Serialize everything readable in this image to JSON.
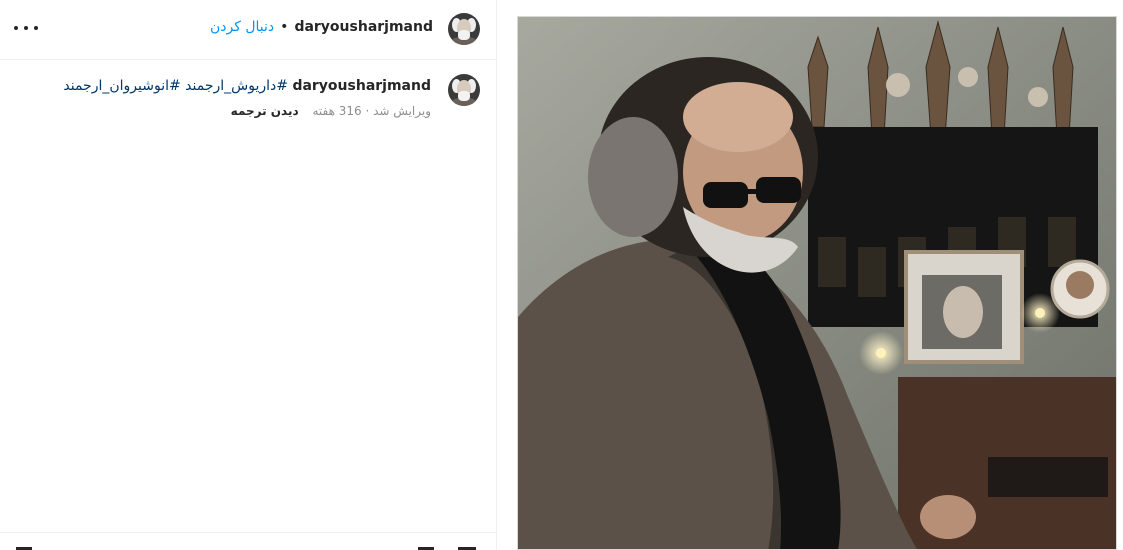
{
  "header": {
    "more_icon": "more-horizontal-icon",
    "follow_label": "دنبال کردن",
    "separator": "•",
    "username": "daryousharjmand"
  },
  "caption": {
    "username": "daryousharjmand",
    "hashtags": [
      "#داریوش_ارجمند",
      "#انوشیروان_ارجمند"
    ],
    "meta": "ویرایش شد · 316 هفته",
    "translate_label": "دیدن ترجمه"
  },
  "colors": {
    "link_blue": "#0095f6",
    "hashtag": "#00376b",
    "text": "#262626",
    "muted": "#8e8e8e",
    "border": "#efefef"
  }
}
